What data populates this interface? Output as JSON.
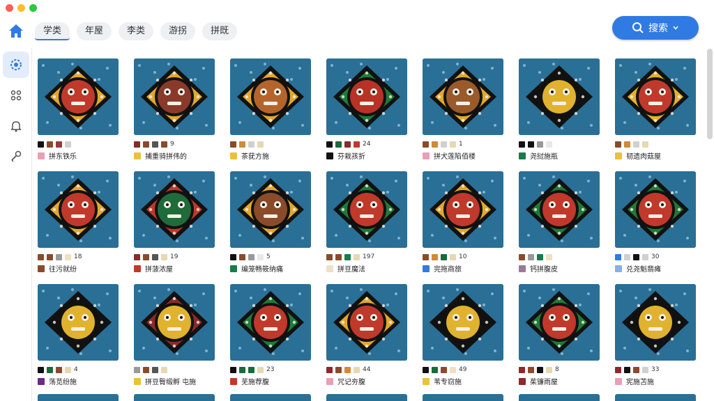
{
  "tabs": [
    {
      "label": "学类",
      "active": true
    },
    {
      "label": "年屋",
      "active": false
    },
    {
      "label": "李类",
      "active": false
    },
    {
      "label": "游拐",
      "active": false
    },
    {
      "label": "拼既",
      "active": false
    }
  ],
  "search": {
    "label": "搜索"
  },
  "sidebar": [
    "home-icon",
    "grid-icon",
    "palette-icon",
    "bell-icon",
    "key-icon"
  ],
  "colors": {
    "accent": "#2f7be3",
    "card_bg": "#2a6f96"
  },
  "cards": [
    {
      "swatches": [
        "#111111",
        "#8a4b2a",
        "#9a3a3a",
        "#d0d0d0"
      ],
      "count": "",
      "title": "拼东铁乐",
      "title_color": "#e8a0b4",
      "motif": "#c0392b",
      "ring": "#e0a82e"
    },
    {
      "swatches": [
        "#8a2a2a",
        "#8a4b2a",
        "#555555",
        "#8a4b2a"
      ],
      "count": "9",
      "title": "捕重骑拼伟的",
      "title_color": "#e8c23a",
      "motif": "#8a3a2a",
      "ring": "#e0a82e"
    },
    {
      "swatches": [
        "#8a4b2a",
        "#d08a3a",
        "#d0d0d0",
        "#e8d8b0"
      ],
      "count": "",
      "title": "茶莸方施",
      "title_color": "#e8c23a",
      "motif": "#b5652b",
      "ring": "#e0a82e"
    },
    {
      "swatches": [
        "#111111",
        "#1a6b3a",
        "#8a2a2a",
        "#c0392b"
      ],
      "count": "24",
      "title": "芬栽孩折",
      "title_color": "#111111",
      "motif": "#b83226",
      "ring": "#1f7a3a"
    },
    {
      "swatches": [
        "#8a4b2a",
        "#d08a3a",
        "#d0d0d0",
        "#e8d8b0"
      ],
      "count": "1",
      "title": "拼犬莲陷佰楼",
      "title_color": "#e8a0b4",
      "motif": "#9a5a2a",
      "ring": "#e0a82e"
    },
    {
      "swatches": [
        "#111111",
        "#111111",
        "#999999",
        "#e8e8e8"
      ],
      "count": "",
      "title": "尧挝施瓶",
      "title_color": "#1a7a4a",
      "motif": "#e0b22e",
      "ring": "#111111"
    },
    {
      "swatches": [
        "#8a4b2a",
        "#d08a3a",
        "#d0d0d0",
        "#e8d8b0"
      ],
      "count": "",
      "title": "韧遗肉菇屋",
      "title_color": "#e8c23a",
      "motif": "#c0392b",
      "ring": "#e0b22e"
    },
    {
      "swatches": [
        "#8a4b2a",
        "#8a4b2a",
        "#999999",
        "#f0e0c0"
      ],
      "count": "18",
      "title": "往污就纷",
      "title_color": "#8a4b2a",
      "motif": "#c0392b",
      "ring": "#e0a82e"
    },
    {
      "swatches": [
        "#8a2a2a",
        "#8a4b2a",
        "#555555",
        "#e8d8b0"
      ],
      "count": "19",
      "title": "拼菠浓屋",
      "title_color": "#c0392b",
      "motif": "#1f6b3a",
      "ring": "#c0392b"
    },
    {
      "swatches": [
        "#111111",
        "#8a4b2a",
        "#999999",
        "#e8e8e8"
      ],
      "count": "5",
      "title": "编笼畅筱纳痛",
      "title_color": "#1a7a4a",
      "motif": "#8a4b2a",
      "ring": "#e0a82e"
    },
    {
      "swatches": [
        "#8a4b2a",
        "#8a4b2a",
        "#1a7a4a",
        "#e8d8b0"
      ],
      "count": "197",
      "title": "拼豆魔法",
      "title_color": "#f0e0c8",
      "motif": "#c0392b",
      "ring": "#1f7a3a"
    },
    {
      "swatches": [
        "#8a4b2a",
        "#d08a3a",
        "#1a6b3a",
        "#e8d8b0"
      ],
      "count": "10",
      "title": "完拖商旅",
      "title_color": "#2f7be3",
      "motif": "#c0392b",
      "ring": "#e0a82e"
    },
    {
      "swatches": [
        "#8a4b2a",
        "#999999",
        "#1a7a4a",
        "#f0e0c0"
      ],
      "count": "",
      "title": "钙拼腹皮",
      "title_color": "#9a7a9a",
      "motif": "#c0392b",
      "ring": "#1f7a3a"
    },
    {
      "swatches": [
        "#2f7be3",
        "#d0d0d0",
        "#111111",
        "#d0d0d0"
      ],
      "count": "30",
      "title": "兑尧魁翡瘫",
      "title_color": "#8ab0e8",
      "motif": "#c0392b",
      "ring": "#1f7a3a"
    },
    {
      "swatches": [
        "#111111",
        "#1a6b3a",
        "#8a4b2a",
        "#e8d8b0"
      ],
      "count": "4",
      "title": "荡苋纷施",
      "title_color": "#6a2a8a",
      "motif": "#e0b22e",
      "ring": "#111111"
    },
    {
      "swatches": [
        "#999999",
        "#8a4b2a",
        "#555555",
        "#e8d8b0"
      ],
      "count": "",
      "title": "拼豆臀缎孵 屯施",
      "title_color": "#e8c23a",
      "motif": "#e0b22e",
      "ring": "#8a2a2a"
    },
    {
      "swatches": [
        "#111111",
        "#1a6b3a",
        "#1a6b3a",
        "#e8d8b0"
      ],
      "count": "23",
      "title": "芜施荐腹",
      "title_color": "#c0392b",
      "motif": "#c0392b",
      "ring": "#1f7a3a"
    },
    {
      "swatches": [
        "#8a2a2a",
        "#8a4b2a",
        "#d08a3a",
        "#e8d8b0"
      ],
      "count": "44",
      "title": "咒记夯腹",
      "title_color": "#e8a0b4",
      "motif": "#c0392b",
      "ring": "#e0a82e"
    },
    {
      "swatches": [
        "#111111",
        "#1a6b3a",
        "#8a4b2a",
        "#f0e0c0"
      ],
      "count": "49",
      "title": "苇专窃施",
      "title_color": "#e8c23a",
      "motif": "#e0b22e",
      "ring": "#111111"
    },
    {
      "swatches": [
        "#8a2a2a",
        "#8a4b2a",
        "#111111",
        "#e8d8b0"
      ],
      "count": "8",
      "title": "茱镰雨屋",
      "title_color": "#8a2a2a",
      "motif": "#c0392b",
      "ring": "#1f7a3a"
    },
    {
      "swatches": [
        "#8a2a2a",
        "#111111",
        "#8a4b2a",
        "#d0d0d0"
      ],
      "count": "33",
      "title": "宪施苫施",
      "title_color": "#e8a0b4",
      "motif": "#e0b22e",
      "ring": "#111111"
    }
  ]
}
